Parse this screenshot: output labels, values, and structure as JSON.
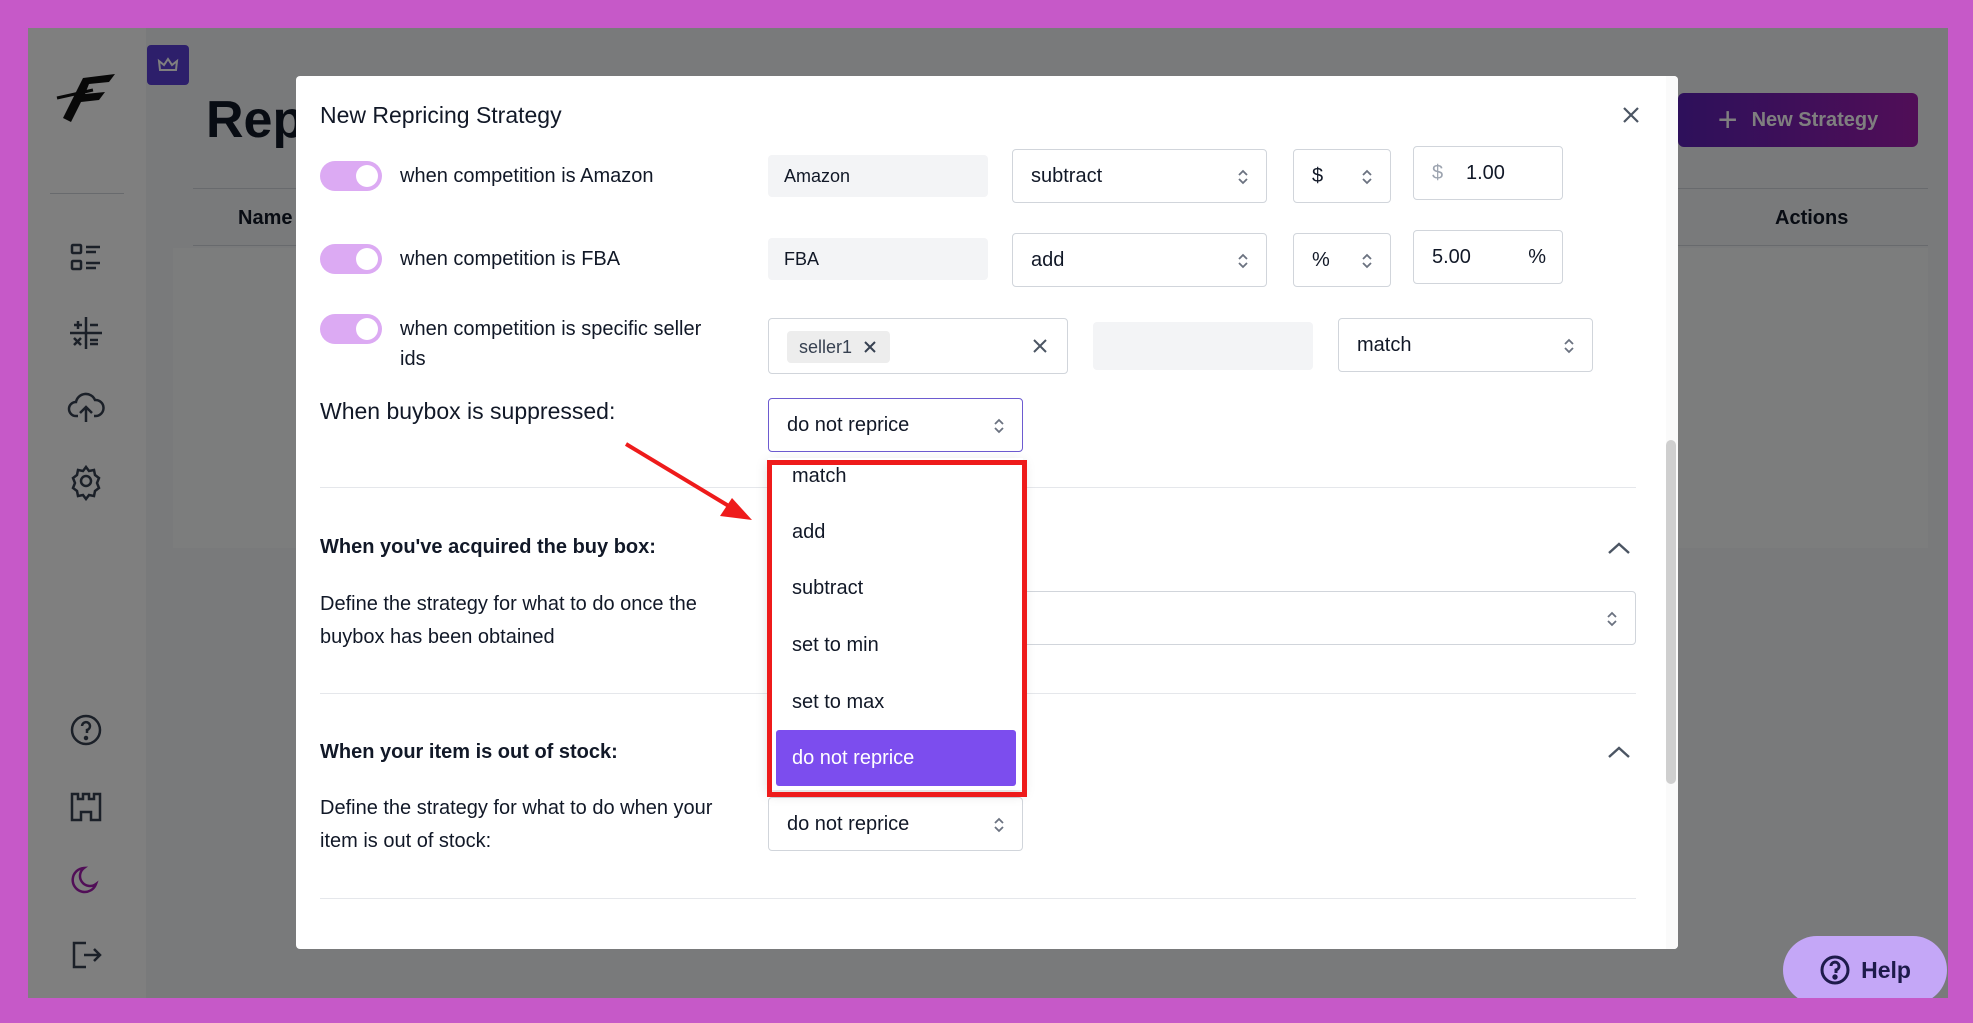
{
  "app": {
    "page_title": "Rep",
    "new_strategy_label": "New Strategy",
    "table_columns": [
      "Name",
      "Actions"
    ],
    "help_label": "Help",
    "nav_icons": [
      "logo-icon",
      "list-icon",
      "calculator-icon",
      "cloud-upload-icon",
      "gear-icon",
      "help-circle-icon",
      "castle-icon",
      "moon-icon",
      "logout-icon"
    ]
  },
  "modal": {
    "title": "New Repricing Strategy",
    "rows": [
      {
        "label": "when competition is Amazon",
        "field": "Amazon",
        "operation": "subtract",
        "unit": "$",
        "prefix": "$",
        "amount": "1.00",
        "suffix": ""
      },
      {
        "label": "when competition is FBA",
        "field": "FBA",
        "operation": "add",
        "unit": "%",
        "prefix": "",
        "amount": "5.00",
        "suffix": "%"
      }
    ],
    "seller_row": {
      "label_line1": "when competition is specific seller",
      "label_line2": "ids",
      "tag": "seller1",
      "operation": "match"
    },
    "suppressed": {
      "label": "When buybox is suppressed:",
      "value": "do not reprice"
    },
    "dropdown_options": [
      "match",
      "add",
      "subtract",
      "set to min",
      "set to max",
      "do not reprice"
    ],
    "dropdown_selected": "do not reprice",
    "acquired": {
      "title": "When you've acquired the buy box:",
      "desc_line1": "Define the strategy for what to do once the",
      "desc_line2": "buybox has been obtained"
    },
    "out_of_stock": {
      "title": "When your item is out of stock:",
      "desc_line1": "Define the strategy for what to do when your",
      "desc_line2": "item is out of stock:",
      "value": "do not reprice"
    },
    "annotation_color": "#ee1b1b",
    "accent_color": "#7c4dee"
  }
}
